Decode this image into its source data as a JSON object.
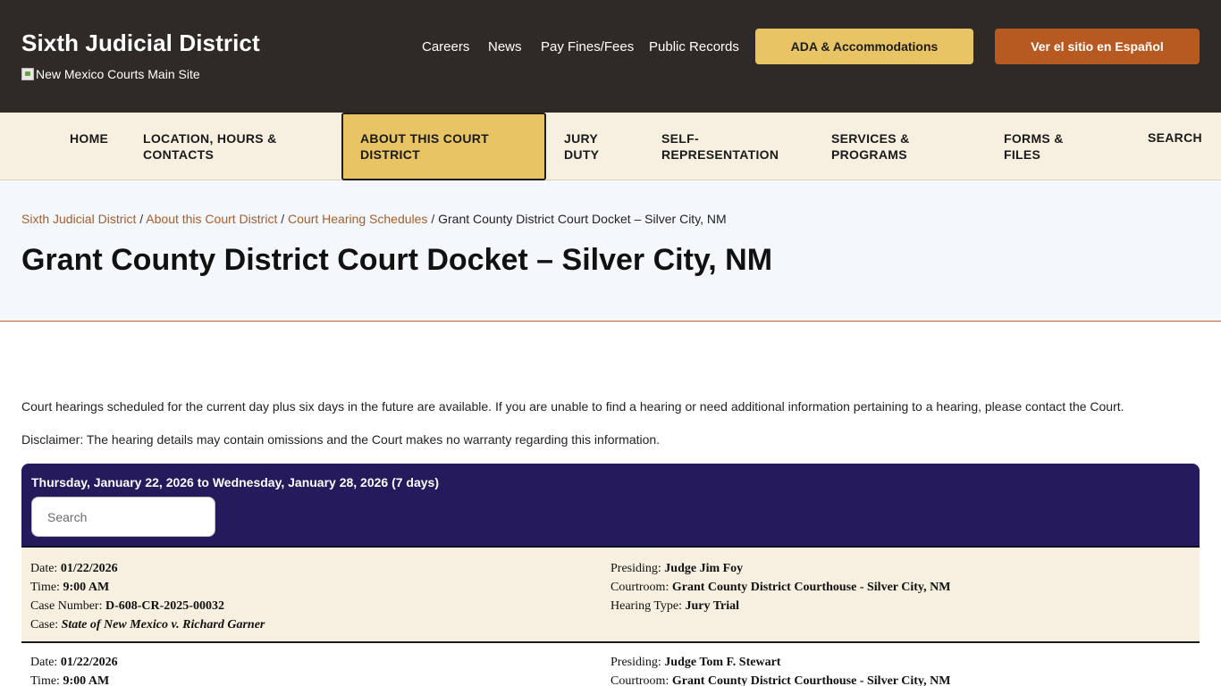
{
  "header": {
    "site_title": "Sixth Judicial District",
    "logo_alt": "New Mexico Courts Main Site",
    "utility_links": [
      "Careers",
      "News",
      "Pay Fines/Fees",
      "Public Records"
    ],
    "ada_button": "ADA & Accommodations",
    "spanish_button": "Ver el sitio en Español"
  },
  "nav": {
    "items": [
      {
        "label": "HOME"
      },
      {
        "label": "LOCATION, HOURS & CONTACTS"
      },
      {
        "label": "ABOUT THIS COURT DISTRICT",
        "active": true
      },
      {
        "label": "JURY DUTY"
      },
      {
        "label": "SELF-REPRESENTATION"
      },
      {
        "label": "SERVICES & PROGRAMS"
      },
      {
        "label": "FORMS & FILES"
      },
      {
        "label": "SEARCH"
      }
    ]
  },
  "breadcrumb": {
    "items": [
      "Sixth Judicial District",
      "About this Court District",
      "Court Hearing Schedules"
    ],
    "current": "Grant County District Court Docket – Silver City, NM",
    "separator": "/"
  },
  "page": {
    "title": "Grant County District Court Docket – Silver City, NM",
    "intro": "Court hearings scheduled for the current day plus six days in the future are available. If you are unable to find a hearing or need additional information pertaining to a hearing, please contact the Court.",
    "disclaimer": "Disclaimer:  The hearing details may contain omissions and the Court makes no warranty regarding this information."
  },
  "docket": {
    "range": "Thursday, January 22, 2026 to Wednesday, January 28, 2026 (7 days)",
    "search_placeholder": "Search",
    "labels": {
      "date": "Date:",
      "time": "Time:",
      "case_number": "Case Number:",
      "case": "Case:",
      "presiding": "Presiding:",
      "courtroom": "Courtroom:",
      "hearing_type": "Hearing Type:"
    },
    "hearings": [
      {
        "date": "01/22/2026",
        "time": "9:00 AM",
        "case_number": "D-608-CR-2025-00032",
        "case": "State of New Mexico v. Richard Garner",
        "presiding": "Judge Jim Foy",
        "courtroom": "Grant County District Courthouse - Silver City, NM",
        "hearing_type": "Jury Trial"
      },
      {
        "date": "01/22/2026",
        "time": "9:00 AM",
        "presiding": "Judge Tom F. Stewart",
        "courtroom": "Grant County District Courthouse - Silver City, NM"
      }
    ]
  },
  "colors": {
    "header_bg": "#302a27",
    "nav_bg": "#f7f0e1",
    "accent_gold": "#e8c465",
    "accent_rust": "#b65a22",
    "docket_header": "#251a5c",
    "link": "#a45e2d"
  }
}
